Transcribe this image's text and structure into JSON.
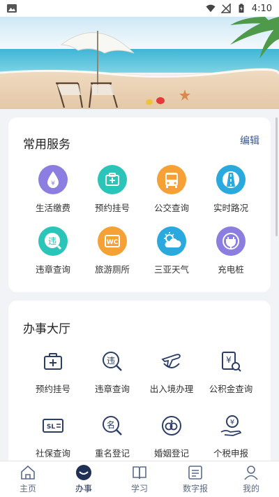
{
  "status_bar": {
    "time": "4:10"
  },
  "services": {
    "title": "常用服务",
    "edit_label": "编辑",
    "items": [
      {
        "label": "生活缴费",
        "icon": "water-drop-yen-icon",
        "color": "#8b7ee0"
      },
      {
        "label": "预约挂号",
        "icon": "medical-kit-icon",
        "color": "#2ac5b8"
      },
      {
        "label": "公交查询",
        "icon": "bus-icon",
        "color": "#f5a136"
      },
      {
        "label": "实时路况",
        "icon": "road-icon",
        "color": "#2aa9de"
      },
      {
        "label": "违章查询",
        "icon": "violation-icon",
        "color": "#2ac5b8"
      },
      {
        "label": "旅游厕所",
        "icon": "wc-icon",
        "color": "#f5a136"
      },
      {
        "label": "三亚天气",
        "icon": "weather-icon",
        "color": "#2aa9de"
      },
      {
        "label": "充电桩",
        "icon": "charging-plug-icon",
        "color": "#8b7ee0"
      }
    ]
  },
  "hall": {
    "title": "办事大厅",
    "items": [
      {
        "label": "预约挂号",
        "icon": "medical-kit-outline-icon"
      },
      {
        "label": "违章查询",
        "icon": "violation-outline-icon"
      },
      {
        "label": "出入境办理",
        "icon": "airplane-globe-icon"
      },
      {
        "label": "公积金查询",
        "icon": "yen-document-search-icon"
      },
      {
        "label": "社保查询",
        "icon": "sl-card-icon"
      },
      {
        "label": "重名登记",
        "icon": "name-search-icon"
      },
      {
        "label": "婚姻登记",
        "icon": "marriage-icon"
      },
      {
        "label": "个税申报",
        "icon": "yen-hand-icon"
      }
    ]
  },
  "tabbar": {
    "items": [
      {
        "label": "主页",
        "icon": "home-icon"
      },
      {
        "label": "办事",
        "icon": "service-icon",
        "active": true
      },
      {
        "label": "学习",
        "icon": "book-icon"
      },
      {
        "label": "数字报",
        "icon": "newspaper-icon"
      },
      {
        "label": "我的",
        "icon": "user-icon"
      }
    ]
  },
  "colors": {
    "accent_dark": "#1f3056",
    "tab_inactive": "#5a6a88",
    "outline_icon": "#2c3e66"
  }
}
